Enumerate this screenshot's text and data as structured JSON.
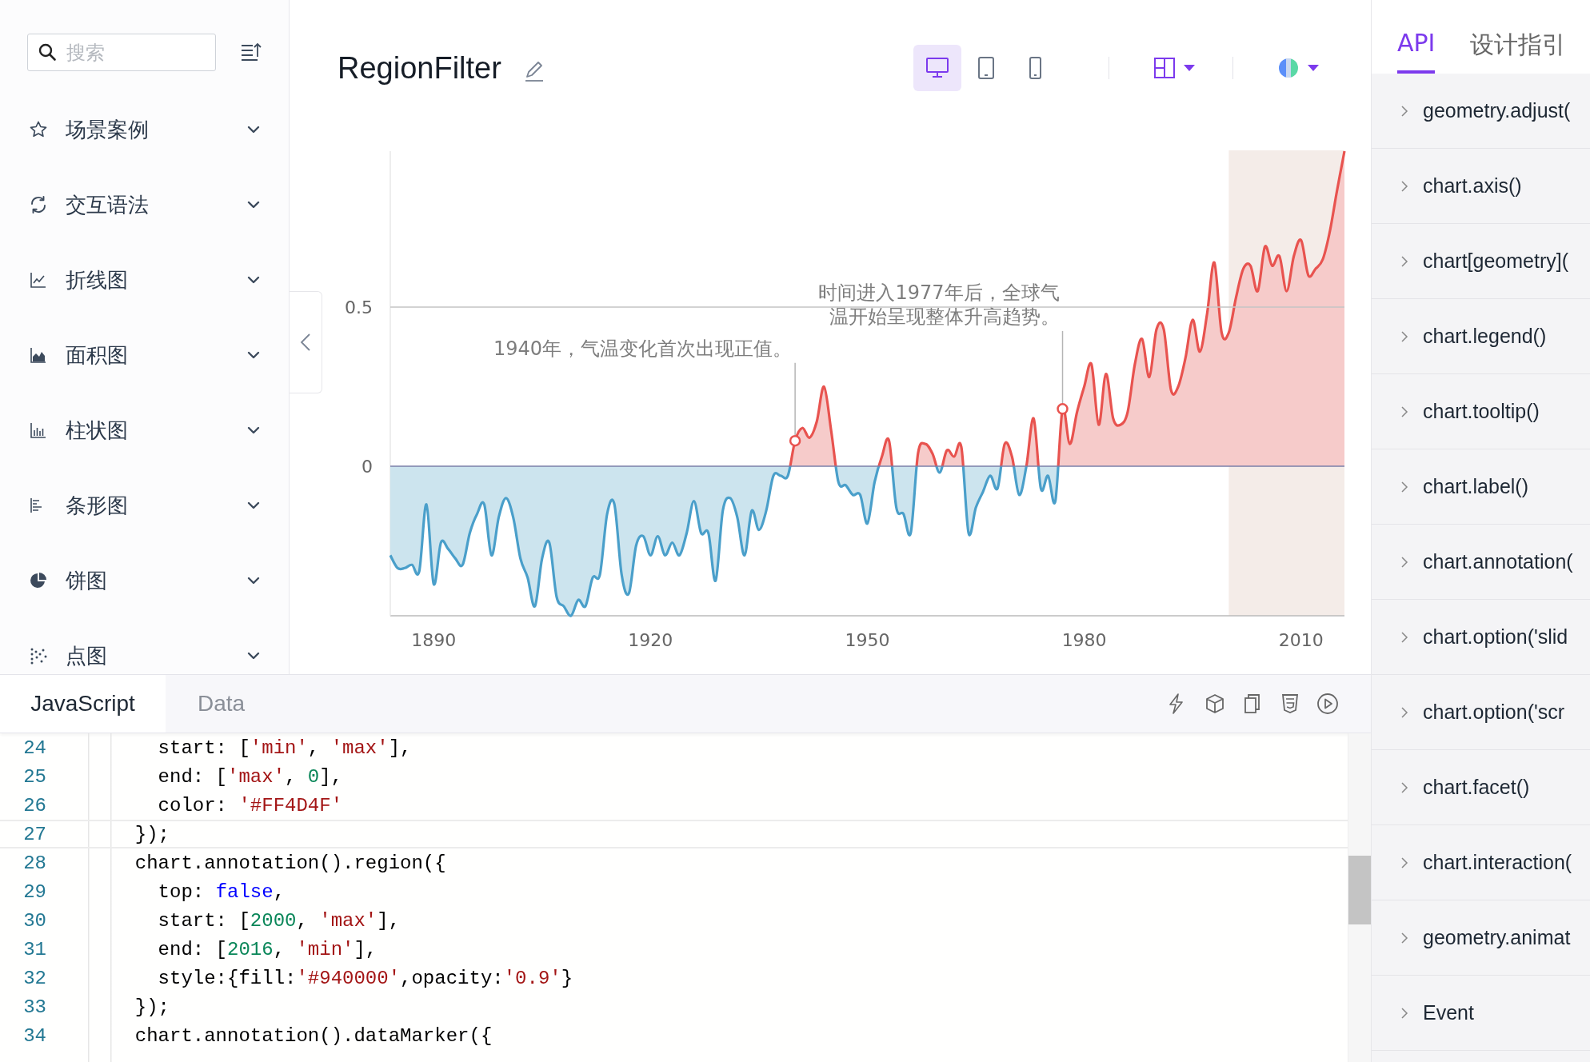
{
  "sidebar": {
    "search": {
      "placeholder": "搜索"
    },
    "items": [
      {
        "label": "场景案例",
        "kind": "star",
        "expanded": false
      },
      {
        "label": "交互语法",
        "kind": "refresh",
        "expanded": false
      },
      {
        "label": "折线图",
        "kind": "line",
        "expanded": false
      },
      {
        "label": "面积图",
        "kind": "area",
        "expanded": false
      },
      {
        "label": "柱状图",
        "kind": "column",
        "expanded": false
      },
      {
        "label": "条形图",
        "kind": "bar",
        "expanded": false
      },
      {
        "label": "饼图",
        "kind": "pie",
        "expanded": false
      },
      {
        "label": "点图",
        "kind": "scatter",
        "expanded": false
      }
    ]
  },
  "header": {
    "title": "RegionFilter",
    "devices": [
      {
        "kind": "desktop",
        "selected": true
      },
      {
        "kind": "tablet",
        "selected": false
      },
      {
        "kind": "mobile",
        "selected": false
      }
    ]
  },
  "chart": {
    "chart_data": {
      "type": "area",
      "xlim": [
        1884,
        2016
      ],
      "ylim": [
        -0.47,
        0.99
      ],
      "xticks": [
        1890,
        1920,
        1950,
        1980,
        2010
      ],
      "yticks": [
        0,
        0.5
      ],
      "x": [
        1884,
        1885,
        1886,
        1887,
        1888,
        1889,
        1890,
        1891,
        1892,
        1893,
        1894,
        1895,
        1896,
        1897,
        1898,
        1899,
        1900,
        1901,
        1902,
        1903,
        1904,
        1905,
        1906,
        1907,
        1908,
        1909,
        1910,
        1911,
        1912,
        1913,
        1914,
        1915,
        1916,
        1917,
        1918,
        1919,
        1920,
        1921,
        1922,
        1923,
        1924,
        1925,
        1926,
        1927,
        1928,
        1929,
        1930,
        1931,
        1932,
        1933,
        1934,
        1935,
        1936,
        1937,
        1938,
        1939,
        1940,
        1941,
        1942,
        1943,
        1944,
        1945,
        1946,
        1947,
        1948,
        1949,
        1950,
        1951,
        1952,
        1953,
        1954,
        1955,
        1956,
        1957,
        1958,
        1959,
        1960,
        1961,
        1962,
        1963,
        1964,
        1965,
        1966,
        1967,
        1968,
        1969,
        1970,
        1971,
        1972,
        1973,
        1974,
        1975,
        1976,
        1977,
        1978,
        1979,
        1980,
        1981,
        1982,
        1983,
        1984,
        1985,
        1986,
        1987,
        1988,
        1989,
        1990,
        1991,
        1992,
        1993,
        1994,
        1995,
        1996,
        1997,
        1998,
        1999,
        2000,
        2001,
        2002,
        2003,
        2004,
        2005,
        2006,
        2007,
        2008,
        2009,
        2010,
        2011,
        2012,
        2013,
        2014,
        2015,
        2016
      ],
      "series": [
        {
          "color": "#e8534f",
          "values": [
            -0.28,
            -0.32,
            -0.32,
            -0.31,
            -0.33,
            -0.12,
            -0.37,
            -0.24,
            -0.26,
            -0.29,
            -0.31,
            -0.21,
            -0.15,
            -0.12,
            -0.28,
            -0.16,
            -0.1,
            -0.16,
            -0.29,
            -0.35,
            -0.44,
            -0.29,
            -0.24,
            -0.41,
            -0.44,
            -0.47,
            -0.42,
            -0.44,
            -0.35,
            -0.34,
            -0.15,
            -0.12,
            -0.34,
            -0.4,
            -0.25,
            -0.22,
            -0.28,
            -0.22,
            -0.28,
            -0.24,
            -0.28,
            -0.21,
            -0.11,
            -0.21,
            -0.21,
            -0.36,
            -0.14,
            -0.1,
            -0.16,
            -0.28,
            -0.14,
            -0.2,
            -0.14,
            -0.03,
            -0.03,
            -0.03,
            0.08,
            0.12,
            0.09,
            0.14,
            0.25,
            0.11,
            -0.05,
            -0.06,
            -0.09,
            -0.09,
            -0.18,
            -0.05,
            0.03,
            0.08,
            -0.13,
            -0.15,
            -0.21,
            0.04,
            0.07,
            0.04,
            -0.02,
            0.05,
            0.03,
            0.06,
            -0.21,
            -0.13,
            -0.08,
            -0.03,
            -0.07,
            0.07,
            0.03,
            -0.09,
            0.0,
            0.15,
            -0.07,
            -0.03,
            -0.11,
            0.18,
            0.07,
            0.17,
            0.25,
            0.32,
            0.13,
            0.29,
            0.15,
            0.13,
            0.17,
            0.32,
            0.4,
            0.28,
            0.43,
            0.43,
            0.24,
            0.25,
            0.34,
            0.46,
            0.36,
            0.48,
            0.64,
            0.42,
            0.42,
            0.53,
            0.62,
            0.63,
            0.55,
            0.69,
            0.63,
            0.66,
            0.55,
            0.66,
            0.71,
            0.6,
            0.62,
            0.65,
            0.74,
            0.87,
            0.99
          ]
        }
      ],
      "ref_lines": [
        {
          "axis": "y",
          "value": 0,
          "color": "#7b7fa8"
        },
        {
          "axis": "y",
          "value": 0.5,
          "color": "#c4c4c4"
        }
      ],
      "bands": [
        {
          "axis": "x",
          "from": 2000,
          "to": 2016
        }
      ],
      "annotations": [
        {
          "text": "1940年，气温变化首次出现正值。",
          "x": 1940,
          "y": 0.08
        },
        {
          "text": "时间进入1977年后，全球气温开始呈现整体升高趋势。",
          "x": 1977,
          "y": 0.18
        }
      ]
    }
  },
  "editor": {
    "tabs": [
      {
        "label": "JavaScript",
        "selected": true
      },
      {
        "label": "Data",
        "selected": false
      }
    ],
    "lines": [
      {
        "number": "24",
        "current": false,
        "tokens": [
          {
            "kind": "plain",
            "text": "    start: ["
          },
          {
            "kind": "string",
            "text": "'min'"
          },
          {
            "kind": "plain",
            "text": ", "
          },
          {
            "kind": "string",
            "text": "'max'"
          },
          {
            "kind": "plain",
            "text": "],"
          }
        ]
      },
      {
        "number": "25",
        "current": false,
        "tokens": [
          {
            "kind": "plain",
            "text": "    end: ["
          },
          {
            "kind": "string",
            "text": "'max'"
          },
          {
            "kind": "plain",
            "text": ", "
          },
          {
            "kind": "number",
            "text": "0"
          },
          {
            "kind": "plain",
            "text": "],"
          }
        ]
      },
      {
        "number": "26",
        "current": false,
        "tokens": [
          {
            "kind": "plain",
            "text": "    color: "
          },
          {
            "kind": "string",
            "text": "'#FF4D4F'"
          }
        ]
      },
      {
        "number": "27",
        "current": true,
        "tokens": [
          {
            "kind": "plain",
            "text": "  });"
          }
        ]
      },
      {
        "number": "28",
        "current": false,
        "tokens": [
          {
            "kind": "plain",
            "text": "  chart.annotation().region({"
          }
        ]
      },
      {
        "number": "29",
        "current": false,
        "tokens": [
          {
            "kind": "plain",
            "text": "    top: "
          },
          {
            "kind": "keyword",
            "text": "false"
          },
          {
            "kind": "plain",
            "text": ","
          }
        ]
      },
      {
        "number": "30",
        "current": false,
        "tokens": [
          {
            "kind": "plain",
            "text": "    start: ["
          },
          {
            "kind": "number",
            "text": "2000"
          },
          {
            "kind": "plain",
            "text": ", "
          },
          {
            "kind": "string",
            "text": "'max'"
          },
          {
            "kind": "plain",
            "text": "],"
          }
        ]
      },
      {
        "number": "31",
        "current": false,
        "tokens": [
          {
            "kind": "plain",
            "text": "    end: ["
          },
          {
            "kind": "number",
            "text": "2016"
          },
          {
            "kind": "plain",
            "text": ", "
          },
          {
            "kind": "string",
            "text": "'min'"
          },
          {
            "kind": "plain",
            "text": "],"
          }
        ]
      },
      {
        "number": "32",
        "current": false,
        "tokens": [
          {
            "kind": "plain",
            "text": "    style:{fill:"
          },
          {
            "kind": "string",
            "text": "'#940000'"
          },
          {
            "kind": "plain",
            "text": ",opacity:"
          },
          {
            "kind": "string",
            "text": "'0.9'"
          },
          {
            "kind": "plain",
            "text": "}"
          }
        ]
      },
      {
        "number": "33",
        "current": false,
        "tokens": [
          {
            "kind": "plain",
            "text": "  });"
          }
        ]
      },
      {
        "number": "34",
        "current": false,
        "tokens": [
          {
            "kind": "plain",
            "text": "  chart.annotation().dataMarker({"
          }
        ]
      }
    ]
  },
  "api_panel": {
    "tabs": [
      {
        "label": "API",
        "selected": true
      },
      {
        "label": "设计指引",
        "selected": false
      }
    ],
    "items": [
      {
        "label": "geometry.adjust(",
        "expanded": false
      },
      {
        "label": "chart.axis()",
        "expanded": false
      },
      {
        "label": "chart[geometry](",
        "expanded": false
      },
      {
        "label": "chart.legend()",
        "expanded": false
      },
      {
        "label": "chart.tooltip()",
        "expanded": false
      },
      {
        "label": "chart.label()",
        "expanded": false
      },
      {
        "label": "chart.annotation(",
        "expanded": false
      },
      {
        "label": "chart.option('slid",
        "expanded": false
      },
      {
        "label": "chart.option('scr",
        "expanded": false
      },
      {
        "label": "chart.facet()",
        "expanded": false
      },
      {
        "label": "chart.interaction(",
        "expanded": false
      },
      {
        "label": "geometry.animat",
        "expanded": false
      },
      {
        "label": "Event",
        "expanded": false
      }
    ]
  }
}
